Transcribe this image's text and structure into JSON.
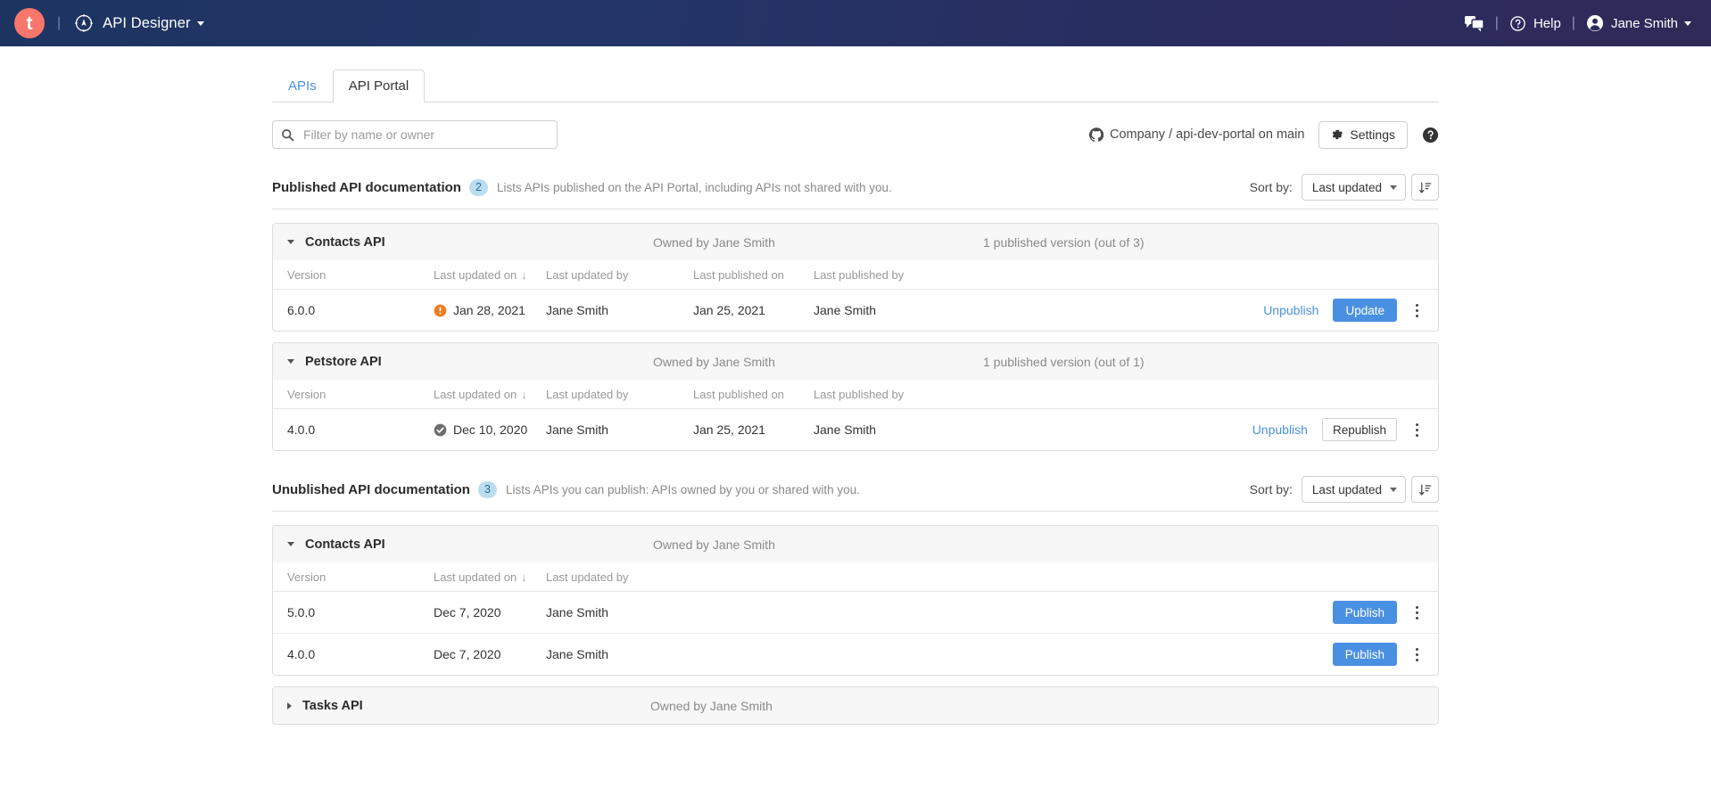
{
  "topbar": {
    "logo_letter": "t",
    "logo_icon": "compass-icon",
    "app_name": "API Designer",
    "chat_icon": "chat-icon",
    "help_label": "Help",
    "help_icon": "question-circle-icon",
    "user_name": "Jane Smith",
    "user_icon": "user-avatar-icon",
    "separator": "|",
    "brand_color": "#f8766b",
    "accent_color": "#4a90e2"
  },
  "tabs": [
    {
      "label": "APIs",
      "active": false
    },
    {
      "label": "API Portal",
      "active": true
    }
  ],
  "filter": {
    "search_placeholder": "Filter by name or owner",
    "search_value": "",
    "search_icon": "search-icon",
    "repo_icon": "github-icon",
    "repo_label": "Company / api-dev-portal on main",
    "settings_label": "Settings",
    "settings_icon": "gear-icon",
    "help_icon": "question-circle-filled-icon"
  },
  "sections": [
    {
      "title": "Published API documentation",
      "count": "2",
      "description": "Lists APIs published on the API Portal, including APIs not shared with you.",
      "sort_by_label": "Sort by:",
      "sort_value": "Last updated",
      "sort_dir_icon": "sort-descending-icon",
      "columns": [
        "Version",
        "Last updated on",
        "Last updated by",
        "Last published on",
        "Last published by"
      ],
      "sorted_column_index": 1,
      "sort_indicator": "↓",
      "groups": [
        {
          "name": "Contacts API",
          "owner": "Owned by Jane Smith",
          "versions_label": "1 published version (out of 3)",
          "expanded": true,
          "rows": [
            {
              "version": "6.0.0",
              "updated_on": "Jan 28, 2021",
              "updated_on_icon": "warning-icon",
              "updated_by": "Jane Smith",
              "published_on": "Jan 25, 2021",
              "published_by": "Jane Smith",
              "link_label": "Unpublish",
              "button_label": "Update",
              "button_style": "primary",
              "menu_icon": "kebab-menu-icon"
            }
          ]
        },
        {
          "name": "Petstore API",
          "owner": "Owned by Jane Smith",
          "versions_label": "1 published version (out of 1)",
          "expanded": true,
          "rows": [
            {
              "version": "4.0.0",
              "updated_on": "Dec 10, 2020",
              "updated_on_icon": "check-circle-icon",
              "updated_by": "Jane Smith",
              "published_on": "Jan 25, 2021",
              "published_by": "Jane Smith",
              "link_label": "Unpublish",
              "button_label": "Republish",
              "button_style": "secondary",
              "menu_icon": "kebab-menu-icon"
            }
          ]
        }
      ]
    },
    {
      "title": "Unublished API documentation",
      "count": "3",
      "description": "Lists APIs you can publish: APIs owned by you or shared with you.",
      "sort_by_label": "Sort by:",
      "sort_value": "Last updated",
      "sort_dir_icon": "sort-descending-icon",
      "columns": [
        "Version",
        "Last updated on",
        "Last updated by"
      ],
      "sorted_column_index": 1,
      "sort_indicator": "↓",
      "groups": [
        {
          "name": "Contacts API",
          "owner": "Owned by Jane Smith",
          "versions_label": "",
          "expanded": true,
          "rows": [
            {
              "version": "5.0.0",
              "updated_on": "Dec 7, 2020",
              "updated_on_icon": "",
              "updated_by": "Jane Smith",
              "link_label": "",
              "button_label": "Publish",
              "button_style": "primary",
              "menu_icon": "kebab-menu-icon"
            },
            {
              "version": "4.0.0",
              "updated_on": "Dec 7, 2020",
              "updated_on_icon": "",
              "updated_by": "Jane Smith",
              "link_label": "",
              "button_label": "Publish",
              "button_style": "primary",
              "menu_icon": "kebab-menu-icon"
            }
          ]
        },
        {
          "name": "Tasks API",
          "owner": "Owned by Jane Smith",
          "versions_label": "",
          "expanded": false,
          "rows": []
        }
      ]
    }
  ]
}
